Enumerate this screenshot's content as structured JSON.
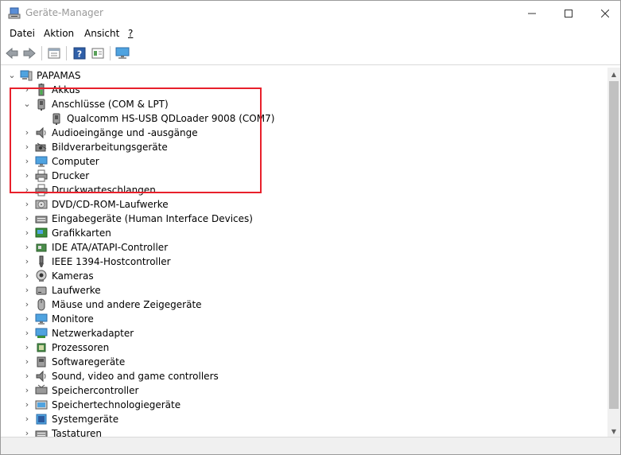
{
  "window": {
    "title": "Geräte-Manager"
  },
  "menu": [
    {
      "key": "datei",
      "label": "Datei"
    },
    {
      "key": "aktion",
      "label": "Aktion"
    },
    {
      "key": "ansicht",
      "label": "Ansicht"
    },
    {
      "key": "help",
      "label": "?"
    }
  ],
  "toolbar": {
    "buttons": [
      {
        "name": "back-button",
        "icon": "arrow-left-icon"
      },
      {
        "name": "forward-button",
        "icon": "arrow-right-icon"
      },
      {
        "name": "properties-button",
        "icon": "properties-icon"
      },
      {
        "name": "help-button",
        "icon": "help-icon"
      },
      {
        "name": "view-button",
        "icon": "view-icon"
      },
      {
        "name": "scan-hardware-button",
        "icon": "monitor-icon"
      }
    ]
  },
  "tree": {
    "root": {
      "label": "PAPAMAS",
      "icon": "computer-icon",
      "expanded": true
    },
    "items": [
      {
        "label": "Akkus",
        "icon": "battery-icon",
        "expanded": false
      },
      {
        "label": "Anschlüsse (COM & LPT)",
        "icon": "port-icon",
        "expanded": true,
        "children": [
          {
            "label": "Qualcomm HS-USB QDLoader 9008 (COM7)",
            "icon": "port-icon"
          }
        ]
      },
      {
        "label": "Audioeingänge und -ausgänge",
        "icon": "speaker-icon",
        "expanded": false
      },
      {
        "label": "Bildverarbeitungsgeräte",
        "icon": "camera-icon",
        "expanded": false
      },
      {
        "label": "Computer",
        "icon": "monitor-icon",
        "expanded": false
      },
      {
        "label": "Drucker",
        "icon": "printer-icon",
        "expanded": false
      },
      {
        "label": "Druckwarteschlangen",
        "icon": "printer-icon",
        "expanded": false
      },
      {
        "label": "DVD/CD-ROM-Laufwerke",
        "icon": "disc-icon",
        "expanded": false
      },
      {
        "label": "Eingabegeräte (Human Interface Devices)",
        "icon": "keyboard-icon",
        "expanded": false
      },
      {
        "label": "Grafikkarten",
        "icon": "display-adapter-icon",
        "expanded": false
      },
      {
        "label": "IDE ATA/ATAPI-Controller",
        "icon": "ide-icon",
        "expanded": false
      },
      {
        "label": "IEEE 1394-Hostcontroller",
        "icon": "firewire-icon",
        "expanded": false
      },
      {
        "label": "Kameras",
        "icon": "webcam-icon",
        "expanded": false
      },
      {
        "label": "Laufwerke",
        "icon": "drive-icon",
        "expanded": false
      },
      {
        "label": "Mäuse und andere Zeigegeräte",
        "icon": "mouse-icon",
        "expanded": false
      },
      {
        "label": "Monitore",
        "icon": "monitor-icon",
        "expanded": false
      },
      {
        "label": "Netzwerkadapter",
        "icon": "network-icon",
        "expanded": false
      },
      {
        "label": "Prozessoren",
        "icon": "cpu-icon",
        "expanded": false
      },
      {
        "label": "Softwaregeräte",
        "icon": "software-device-icon",
        "expanded": false
      },
      {
        "label": "Sound, video and game controllers",
        "icon": "speaker-icon",
        "expanded": false
      },
      {
        "label": "Speichercontroller",
        "icon": "storage-controller-icon",
        "expanded": false
      },
      {
        "label": "Speichertechnologiegeräte",
        "icon": "storage-icon",
        "expanded": false
      },
      {
        "label": "Systemgeräte",
        "icon": "system-icon",
        "expanded": false
      },
      {
        "label": "Tastaturen",
        "icon": "keyboard-icon",
        "expanded": false
      }
    ]
  },
  "colors": {
    "highlight": "#e8202b",
    "accent": "#1979ca"
  }
}
